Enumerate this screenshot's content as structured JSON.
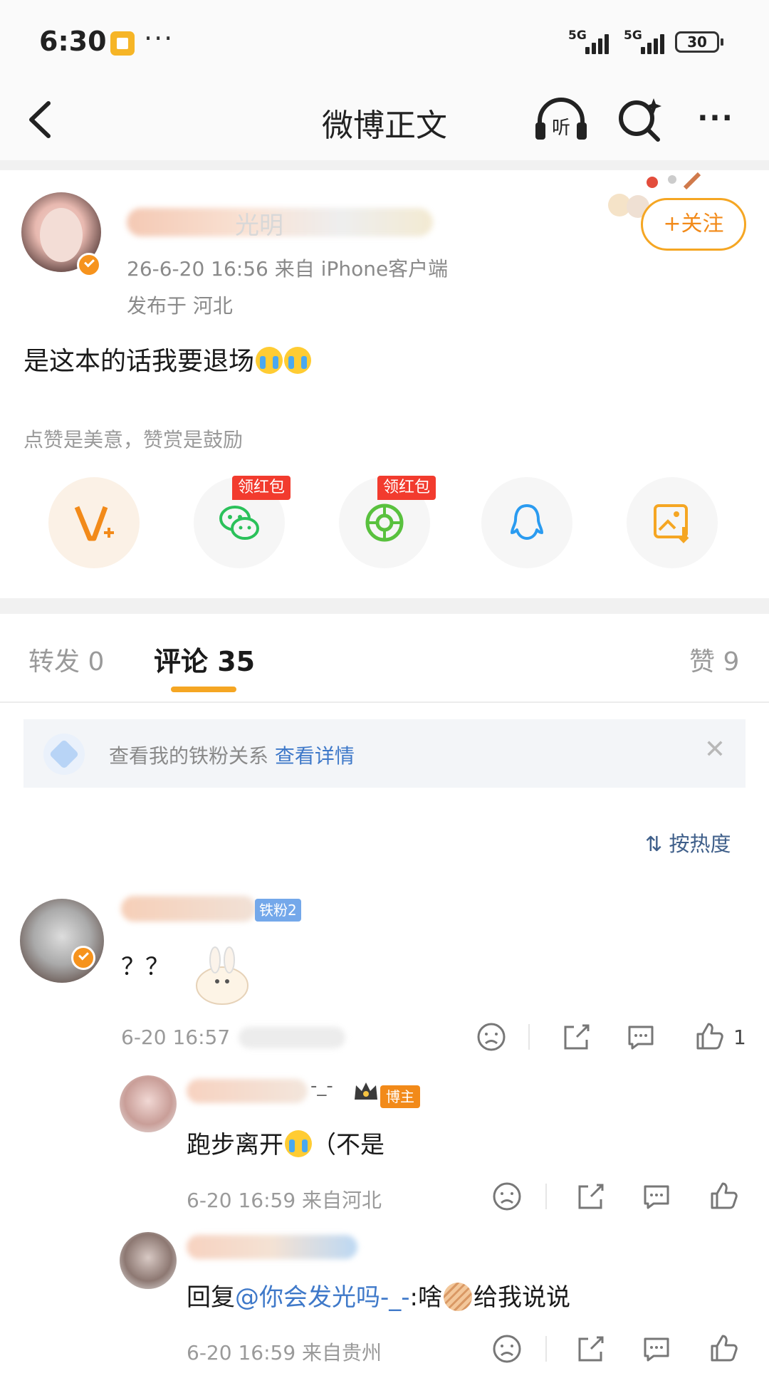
{
  "status_bar": {
    "time": "6:30",
    "dots": "···",
    "signal1": "5G",
    "signal2": "5G",
    "battery": "30"
  },
  "nav": {
    "title": "微博正文",
    "more": "···"
  },
  "post": {
    "name_partial": "光明",
    "meta": "26-6-20 16:56   来自 iPhone客户端",
    "location": "发布于 河北",
    "follow_label": "+关注",
    "text": "是这本的话我要退场",
    "like_hint": "点赞是美意，赞赏是鼓励",
    "redpack_label_1": "领红包",
    "redpack_label_2": "领红包"
  },
  "tabs": {
    "forward": "转发 0",
    "comments": "评论 35",
    "likes": "赞 9"
  },
  "fan_banner": {
    "text": "查看我的铁粉关系",
    "link": "查看详情",
    "close": "✕"
  },
  "sort": {
    "label": "按热度"
  },
  "comments": [
    {
      "badge": "铁粉2",
      "text": "？？",
      "time": "6-20 16:57",
      "like_count": "1"
    },
    {
      "badge": "博主",
      "name_tail": "-_-",
      "text": "跑步离开",
      "text_tail": "（不是",
      "time": "6-20 16:59  来自河北"
    },
    {
      "text_prefix": "回复",
      "mention": "@你会发光吗-_-",
      "text_mid": ":啥",
      "text_tail": "给我说说",
      "time": "6-20 16:59  来自贵州"
    }
  ],
  "colors": {
    "accent": "#f5a623",
    "link": "#3f79c9",
    "redpack": "#f23b2e",
    "wechat": "#2bc15a",
    "qq": "#2a9bf0"
  }
}
